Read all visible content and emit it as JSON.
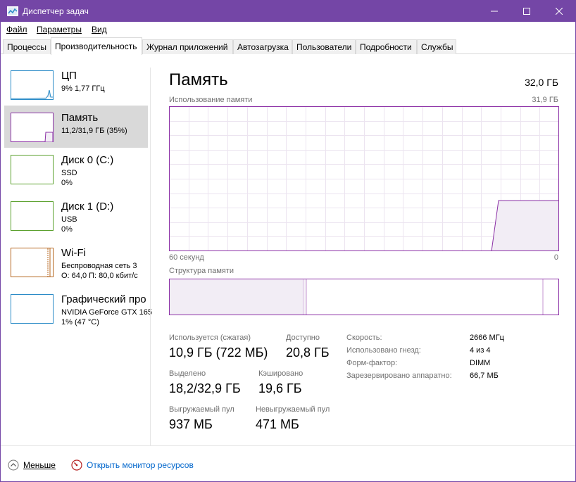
{
  "window": {
    "title": "Диспетчер задач"
  },
  "menu": [
    {
      "label": "Файл"
    },
    {
      "label": "Параметры"
    },
    {
      "label": "Вид"
    }
  ],
  "tabs": [
    {
      "label": "Процессы"
    },
    {
      "label": "Производительность"
    },
    {
      "label": "Журнал приложений"
    },
    {
      "label": "Автозагрузка"
    },
    {
      "label": "Пользователи"
    },
    {
      "label": "Подробности"
    },
    {
      "label": "Службы"
    }
  ],
  "active_tab": "Производительность",
  "sidebar": [
    {
      "title": "ЦП",
      "lines": [
        "9%  1,77 ГГц"
      ],
      "color": "#2a8bc7"
    },
    {
      "title": "Память",
      "lines": [
        "11,2/31,9 ГБ (35%)"
      ],
      "color": "#8b2fa6",
      "selected": true
    },
    {
      "title": "Диск 0 (C:)",
      "lines": [
        "SSD",
        "0%"
      ],
      "color": "#5aa02c"
    },
    {
      "title": "Диск 1 (D:)",
      "lines": [
        "USB",
        "0%"
      ],
      "color": "#5aa02c"
    },
    {
      "title": "Wi-Fi",
      "lines": [
        "Беспроводная сеть 3",
        "О: 64,0  П: 80,0 кбит/с"
      ],
      "color": "#b5651d"
    },
    {
      "title": "Графический про",
      "lines": [
        "NVIDIA GeForce GTX 165",
        "1% (47 °C)"
      ],
      "color": "#2a8bc7"
    }
  ],
  "main": {
    "title": "Память",
    "total": "32,0 ГБ",
    "usage_label": "Использование памяти",
    "usage_max": "31,9 ГБ",
    "time_left": "60 секунд",
    "time_right": "0",
    "structure_label": "Структура памяти",
    "accent_color": "#8b2fa6",
    "usage_fraction": 0.35
  },
  "stats": {
    "in_use_label": "Используется (сжатая)",
    "in_use_value": "10,9 ГБ (722 МБ)",
    "available_label": "Доступно",
    "available_value": "20,8 ГБ",
    "committed_label": "Выделено",
    "committed_value": "18,2/32,9 ГБ",
    "cached_label": "Кэшировано",
    "cached_value": "19,6 ГБ",
    "paged_label": "Выгружаемый пул",
    "paged_value": "937 МБ",
    "nonpaged_label": "Невыгружаемый пул",
    "nonpaged_value": "471 МБ"
  },
  "details": [
    {
      "label": "Скорость:",
      "value": "2666 МГц"
    },
    {
      "label": "Использовано гнезд:",
      "value": "4 из 4"
    },
    {
      "label": "Форм-фактор:",
      "value": "DIMM"
    },
    {
      "label": "Зарезервировано аппаратно:",
      "value": "66,7 МБ"
    }
  ],
  "footer": {
    "fewer_label": "Меньше",
    "resmon_label": "Открыть монитор ресурсов"
  }
}
